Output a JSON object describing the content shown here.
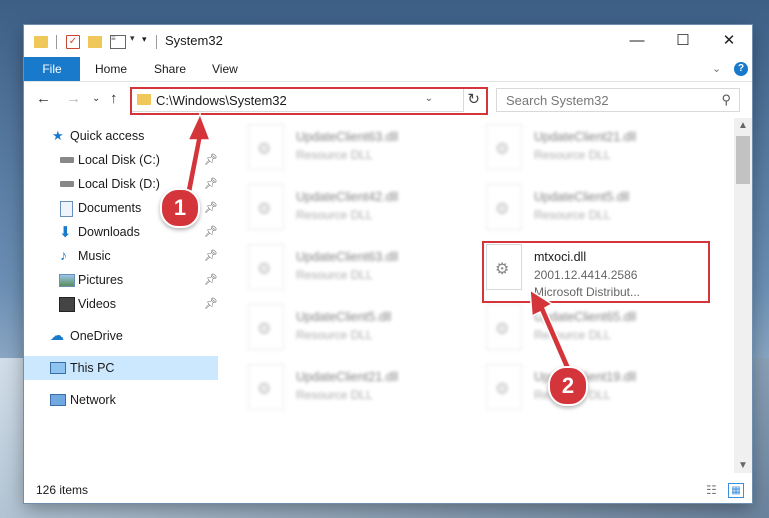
{
  "window": {
    "title": "System32",
    "minimize_icon": "minimize-icon",
    "maximize_icon": "maximize-icon",
    "close_icon": "close-icon"
  },
  "quick_access_toolbar": {
    "dropdown": "▾"
  },
  "ribbon": {
    "tabs": [
      "File",
      "Home",
      "Share",
      "View"
    ]
  },
  "navigation": {
    "address": "C:\\Windows\\System32",
    "search_placeholder": "Search System32"
  },
  "sidebar": {
    "items": [
      {
        "label": "Quick access",
        "icon": "star-icon"
      },
      {
        "label": "Local Disk (C:)",
        "icon": "drive-icon",
        "pinned": true
      },
      {
        "label": "Local Disk (D:)",
        "icon": "drive-icon",
        "pinned": true
      },
      {
        "label": "Documents",
        "icon": "documents-icon",
        "pinned": true
      },
      {
        "label": "Downloads",
        "icon": "downloads-icon",
        "pinned": true
      },
      {
        "label": "Music",
        "icon": "music-icon",
        "pinned": true
      },
      {
        "label": "Pictures",
        "icon": "pictures-icon",
        "pinned": true
      },
      {
        "label": "Videos",
        "icon": "videos-icon",
        "pinned": true
      },
      {
        "label": "OneDrive",
        "icon": "cloud-icon"
      },
      {
        "label": "This PC",
        "icon": "computer-icon",
        "selected": true
      },
      {
        "label": "Network",
        "icon": "network-icon"
      }
    ]
  },
  "files": [
    {
      "name": "UpdateClient63.dll",
      "type": "Resource DLL"
    },
    {
      "name": "UpdateClient21.dll",
      "type": "Resource DLL"
    },
    {
      "name": "UpdateClient42.dll",
      "type": "Resource DLL"
    },
    {
      "name": "UpdateClient5.dll",
      "type": "Resource DLL"
    },
    {
      "name": "UpdateClient63.dll",
      "type": "Resource DLL"
    },
    {
      "name": "UpdateClient5.dll",
      "type": "Resource DLL"
    },
    {
      "name": "UpdateClient65.dll",
      "type": "Resource DLL"
    },
    {
      "name": "UpdateClient21.dll",
      "type": "Resource DLL"
    },
    {
      "name": "UpdateClient19.dll",
      "type": "Resource DLL"
    }
  ],
  "highlighted_file": {
    "name": "mtxoci.dll",
    "version": "2001.12.4414.2586",
    "company": "Microsoft Distribut..."
  },
  "status": {
    "items_count": "126 items"
  },
  "callouts": [
    "1",
    "2"
  ],
  "colors": {
    "accent": "#1979ca",
    "highlight": "#d4353b",
    "selected_bg": "#cce8ff"
  }
}
